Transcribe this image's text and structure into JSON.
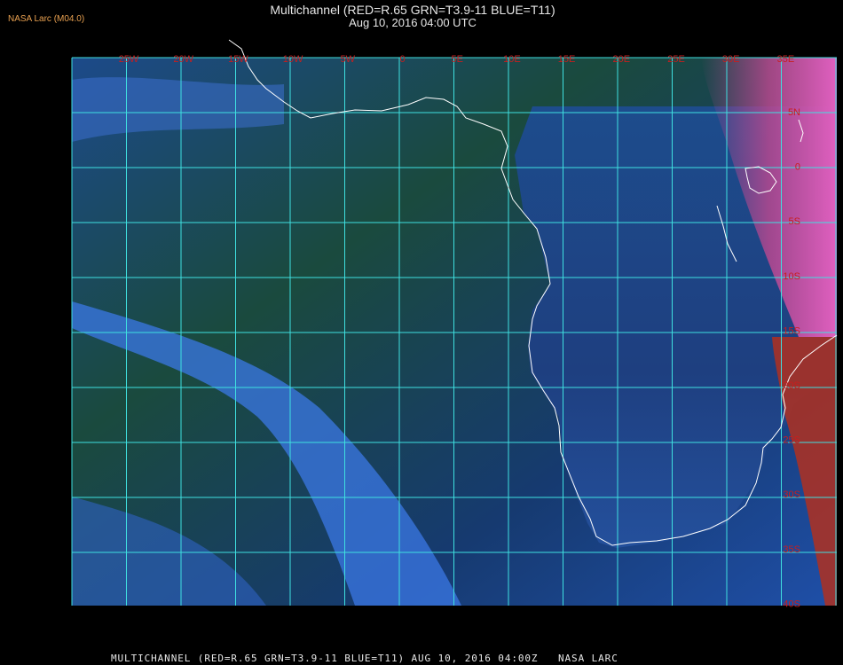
{
  "header": {
    "badge": "NASA Larc (M04.0)",
    "title": "Multichannel (RED=R.65 GRN=T3.9-11 BLUE=T11)",
    "subtitle": "Aug 10, 2016 04:00 UTC"
  },
  "footer": {
    "caption": "MULTICHANNEL (RED=R.65 GRN=T3.9-11 BLUE=T11) AUG 10, 2016 04:00Z   NASA LARC"
  },
  "map": {
    "grid_color": "#3fe0e0",
    "label_color": "#c81e1e",
    "coast_color": "#ffffff",
    "lon_labels": [
      "25W",
      "20W",
      "15W",
      "10W",
      "5W",
      "0",
      "5E",
      "10E",
      "15E",
      "20E",
      "25E",
      "30E",
      "35E"
    ],
    "lat_labels": [
      "5N",
      "0",
      "5S",
      "10S",
      "15S",
      "20S",
      "25S",
      "30S",
      "35S",
      "40S"
    ]
  }
}
